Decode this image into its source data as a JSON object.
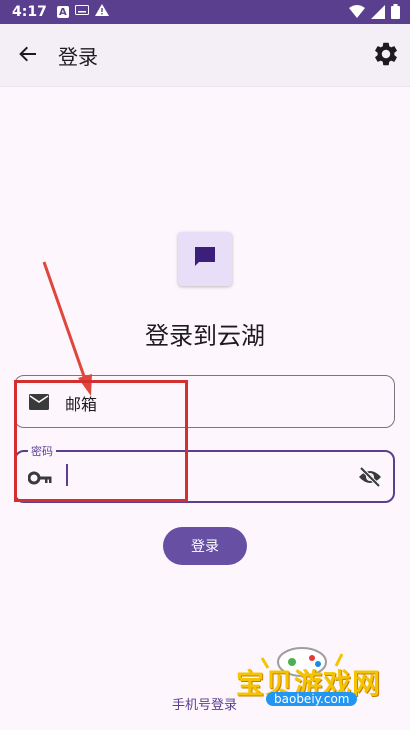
{
  "status_bar": {
    "time": "4:17",
    "notif_a": "A"
  },
  "app_bar": {
    "title": "登录"
  },
  "heading": "登录到云湖",
  "email_field": {
    "placeholder": "邮箱"
  },
  "password_field": {
    "label": "密码",
    "value": ""
  },
  "login_button": {
    "label": "登录"
  },
  "phone_login_link": "手机号登录",
  "watermark": {
    "title": "宝贝游戏网",
    "domain": "baobeiy.com"
  },
  "colors": {
    "primary": "#6750a4",
    "status_bar": "#5b3f8f",
    "annotation": "#d32f2f",
    "background": "#fdf7fd"
  }
}
